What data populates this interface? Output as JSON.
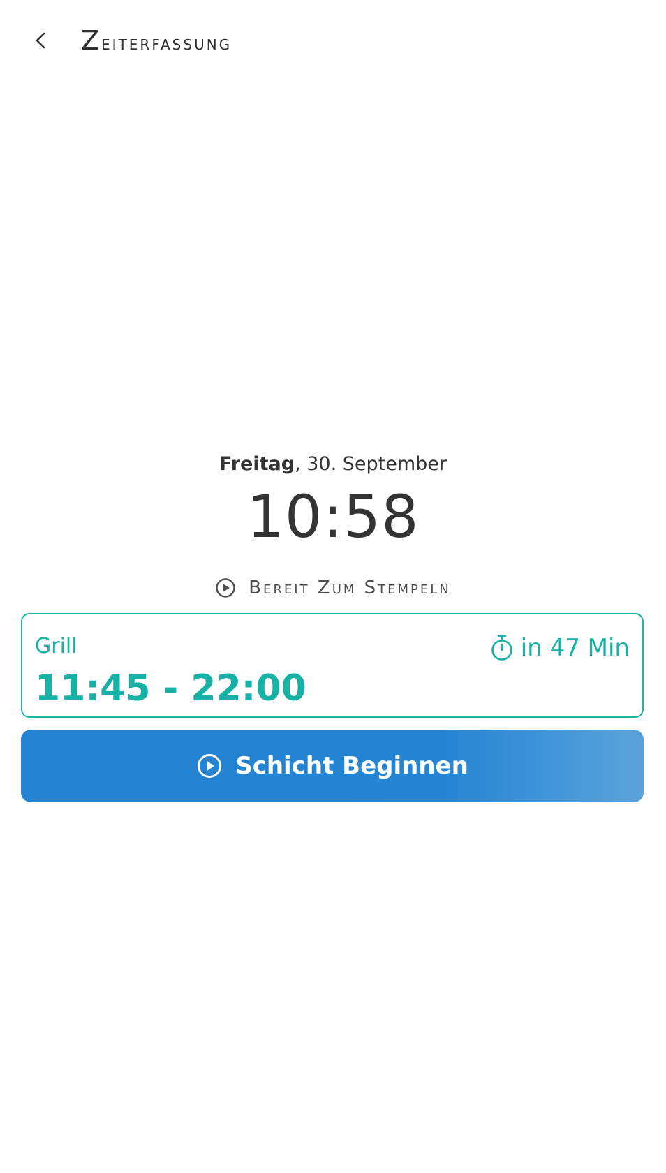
{
  "header": {
    "title": "Zeiterfassung",
    "back_icon": "chevron-left-icon"
  },
  "current": {
    "weekday": "Freitag",
    "date": ", 30. September",
    "time": "10:58"
  },
  "status": {
    "icon": "play-circle-icon",
    "text": "Bereit Zum Stempeln"
  },
  "shift": {
    "name": "Grill",
    "time_range": "11:45 - 22:00",
    "countdown": "in 47 Min",
    "countdown_icon": "stopwatch-icon",
    "accent_color": "#1db3a8"
  },
  "action": {
    "label": "Schicht Beginnen",
    "icon": "play-circle-icon",
    "color": "#2383d2"
  }
}
